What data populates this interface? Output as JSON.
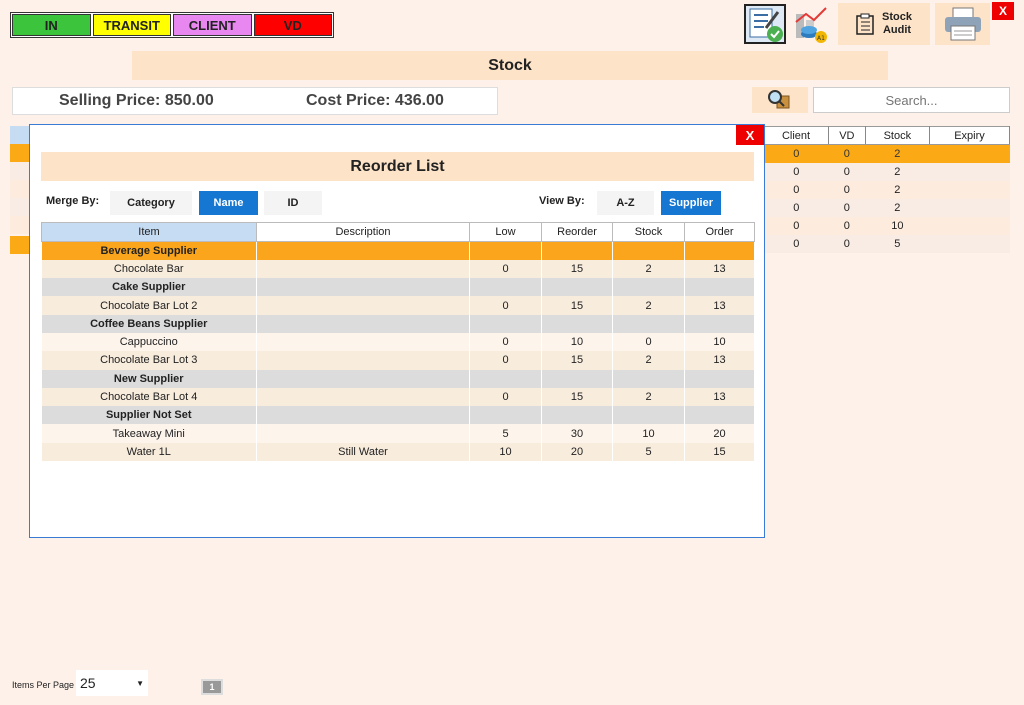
{
  "legend": [
    {
      "label": "IN",
      "color": "#3cc43c"
    },
    {
      "label": "TRANSIT",
      "color": "#ffff00"
    },
    {
      "label": "CLIENT",
      "color": "#e987f0"
    },
    {
      "label": "VD",
      "color": "#ff0000"
    }
  ],
  "toolbar": {
    "stock_audit_line1": "Stock",
    "stock_audit_line2": "Audit",
    "close": "X"
  },
  "page_title": "Stock",
  "prices": {
    "selling": "Selling Price: 850.00",
    "cost": "Cost Price: 436.00"
  },
  "search": {
    "placeholder": "Search..."
  },
  "bg_table": {
    "headers": [
      "Client",
      "VD",
      "Stock",
      "Expiry"
    ],
    "rows": [
      [
        "0",
        "0",
        "2",
        ""
      ],
      [
        "0",
        "0",
        "2",
        ""
      ],
      [
        "0",
        "0",
        "2",
        ""
      ],
      [
        "0",
        "0",
        "2",
        ""
      ],
      [
        "0",
        "0",
        "10",
        ""
      ],
      [
        "0",
        "0",
        "5",
        ""
      ]
    ]
  },
  "modal": {
    "title": "Reorder List",
    "close": "X",
    "merge_by_label": "Merge By:",
    "merge_options": [
      "Category",
      "Name",
      "ID"
    ],
    "merge_selected": "Name",
    "view_by_label": "View By:",
    "view_options": [
      "A-Z",
      "Supplier"
    ],
    "view_selected": "Supplier",
    "columns": [
      "Item",
      "Description",
      "Low",
      "Reorder",
      "Stock",
      "Order"
    ],
    "rows": [
      {
        "type": "supplier",
        "item": "Beverage Supplier"
      },
      {
        "type": "item",
        "item": "Chocolate Bar",
        "description": "",
        "low": "0",
        "reorder": "15",
        "stock": "2",
        "order": "13"
      },
      {
        "type": "supplier",
        "item": "Cake Supplier"
      },
      {
        "type": "item",
        "item": "Chocolate Bar Lot 2",
        "description": "",
        "low": "0",
        "reorder": "15",
        "stock": "2",
        "order": "13"
      },
      {
        "type": "supplier",
        "item": "Coffee Beans Supplier"
      },
      {
        "type": "item",
        "item": "Cappuccino",
        "description": "",
        "low": "0",
        "reorder": "10",
        "stock": "0",
        "order": "10"
      },
      {
        "type": "item",
        "item": "Chocolate Bar Lot 3",
        "description": "",
        "low": "0",
        "reorder": "15",
        "stock": "2",
        "order": "13"
      },
      {
        "type": "supplier",
        "item": "New Supplier"
      },
      {
        "type": "item",
        "item": "Chocolate Bar Lot 4",
        "description": "",
        "low": "0",
        "reorder": "15",
        "stock": "2",
        "order": "13"
      },
      {
        "type": "supplier",
        "item": "Supplier Not Set"
      },
      {
        "type": "item",
        "item": "Takeaway Mini",
        "description": "",
        "low": "5",
        "reorder": "30",
        "stock": "10",
        "order": "20"
      },
      {
        "type": "item",
        "item": "Water 1L",
        "description": "Still Water",
        "low": "10",
        "reorder": "20",
        "stock": "5",
        "order": "15"
      }
    ]
  },
  "footer": {
    "items_per_page_label": "Items Per Page",
    "items_per_page_value": "25",
    "current_page": "1"
  }
}
